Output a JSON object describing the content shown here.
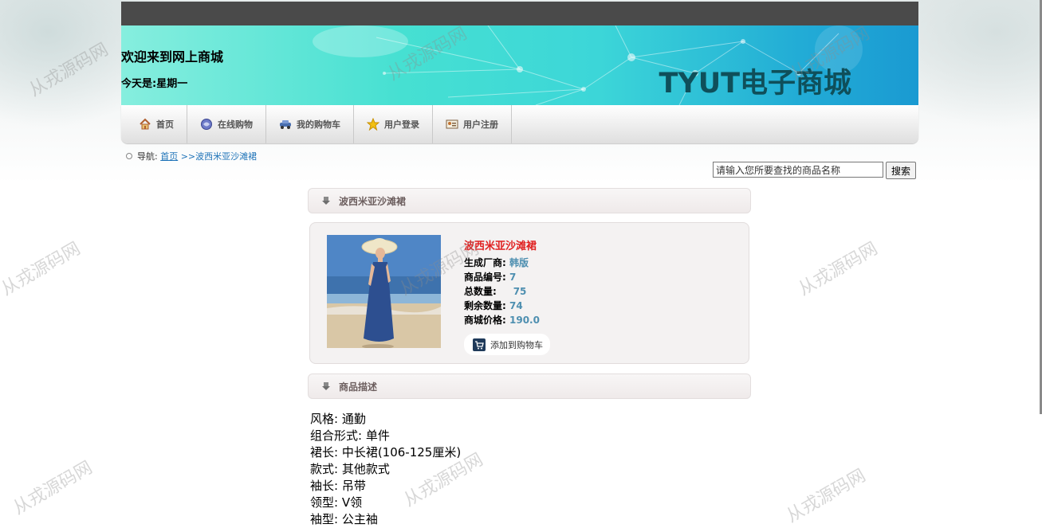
{
  "header": {
    "welcome": "欢迎来到网上商城",
    "today": "今天是:星期一",
    "brand": "TYUT电子商城"
  },
  "menu": [
    {
      "label": "首页",
      "icon": "home-icon"
    },
    {
      "label": "在线购物",
      "icon": "shopping-globe-icon"
    },
    {
      "label": "我的购物车",
      "icon": "car-icon"
    },
    {
      "label": "用户登录",
      "icon": "star-icon"
    },
    {
      "label": "用户注册",
      "icon": "id-card-icon"
    }
  ],
  "breadcrumb": {
    "prefix": "导航:",
    "home_link": "首页",
    "current": ">>波西米亚沙滩裙"
  },
  "search": {
    "value": "请输入您所要查找的商品名称",
    "button_label": "搜索"
  },
  "product_panel": {
    "title": "波西米亚沙滩裙"
  },
  "product": {
    "name": "波西米亚沙滩裙",
    "fields": [
      {
        "key": "生成厂商:",
        "value": "韩版"
      },
      {
        "key": "商品编号:",
        "value": "7"
      },
      {
        "key": "总数量:",
        "value": "75"
      },
      {
        "key": "剩余数量:",
        "value": "74"
      },
      {
        "key": "商城价格:",
        "value": "190.0"
      }
    ],
    "add_to_cart": "添加到购物车"
  },
  "description_panel": {
    "title": "商品描述"
  },
  "description_lines": [
    "风格: 通勤",
    "组合形式: 单件",
    "裙长: 中长裙(106-125厘米)",
    "款式: 其他款式",
    "袖长: 吊带",
    "领型: V领",
    "袖型: 公主袖"
  ],
  "watermark": "从戎源码网",
  "colors": {
    "accent_red": "#e02020",
    "value_blue": "#4e8fb0",
    "brand_text": "#0f4f5a",
    "link_blue": "#1e73b8"
  }
}
